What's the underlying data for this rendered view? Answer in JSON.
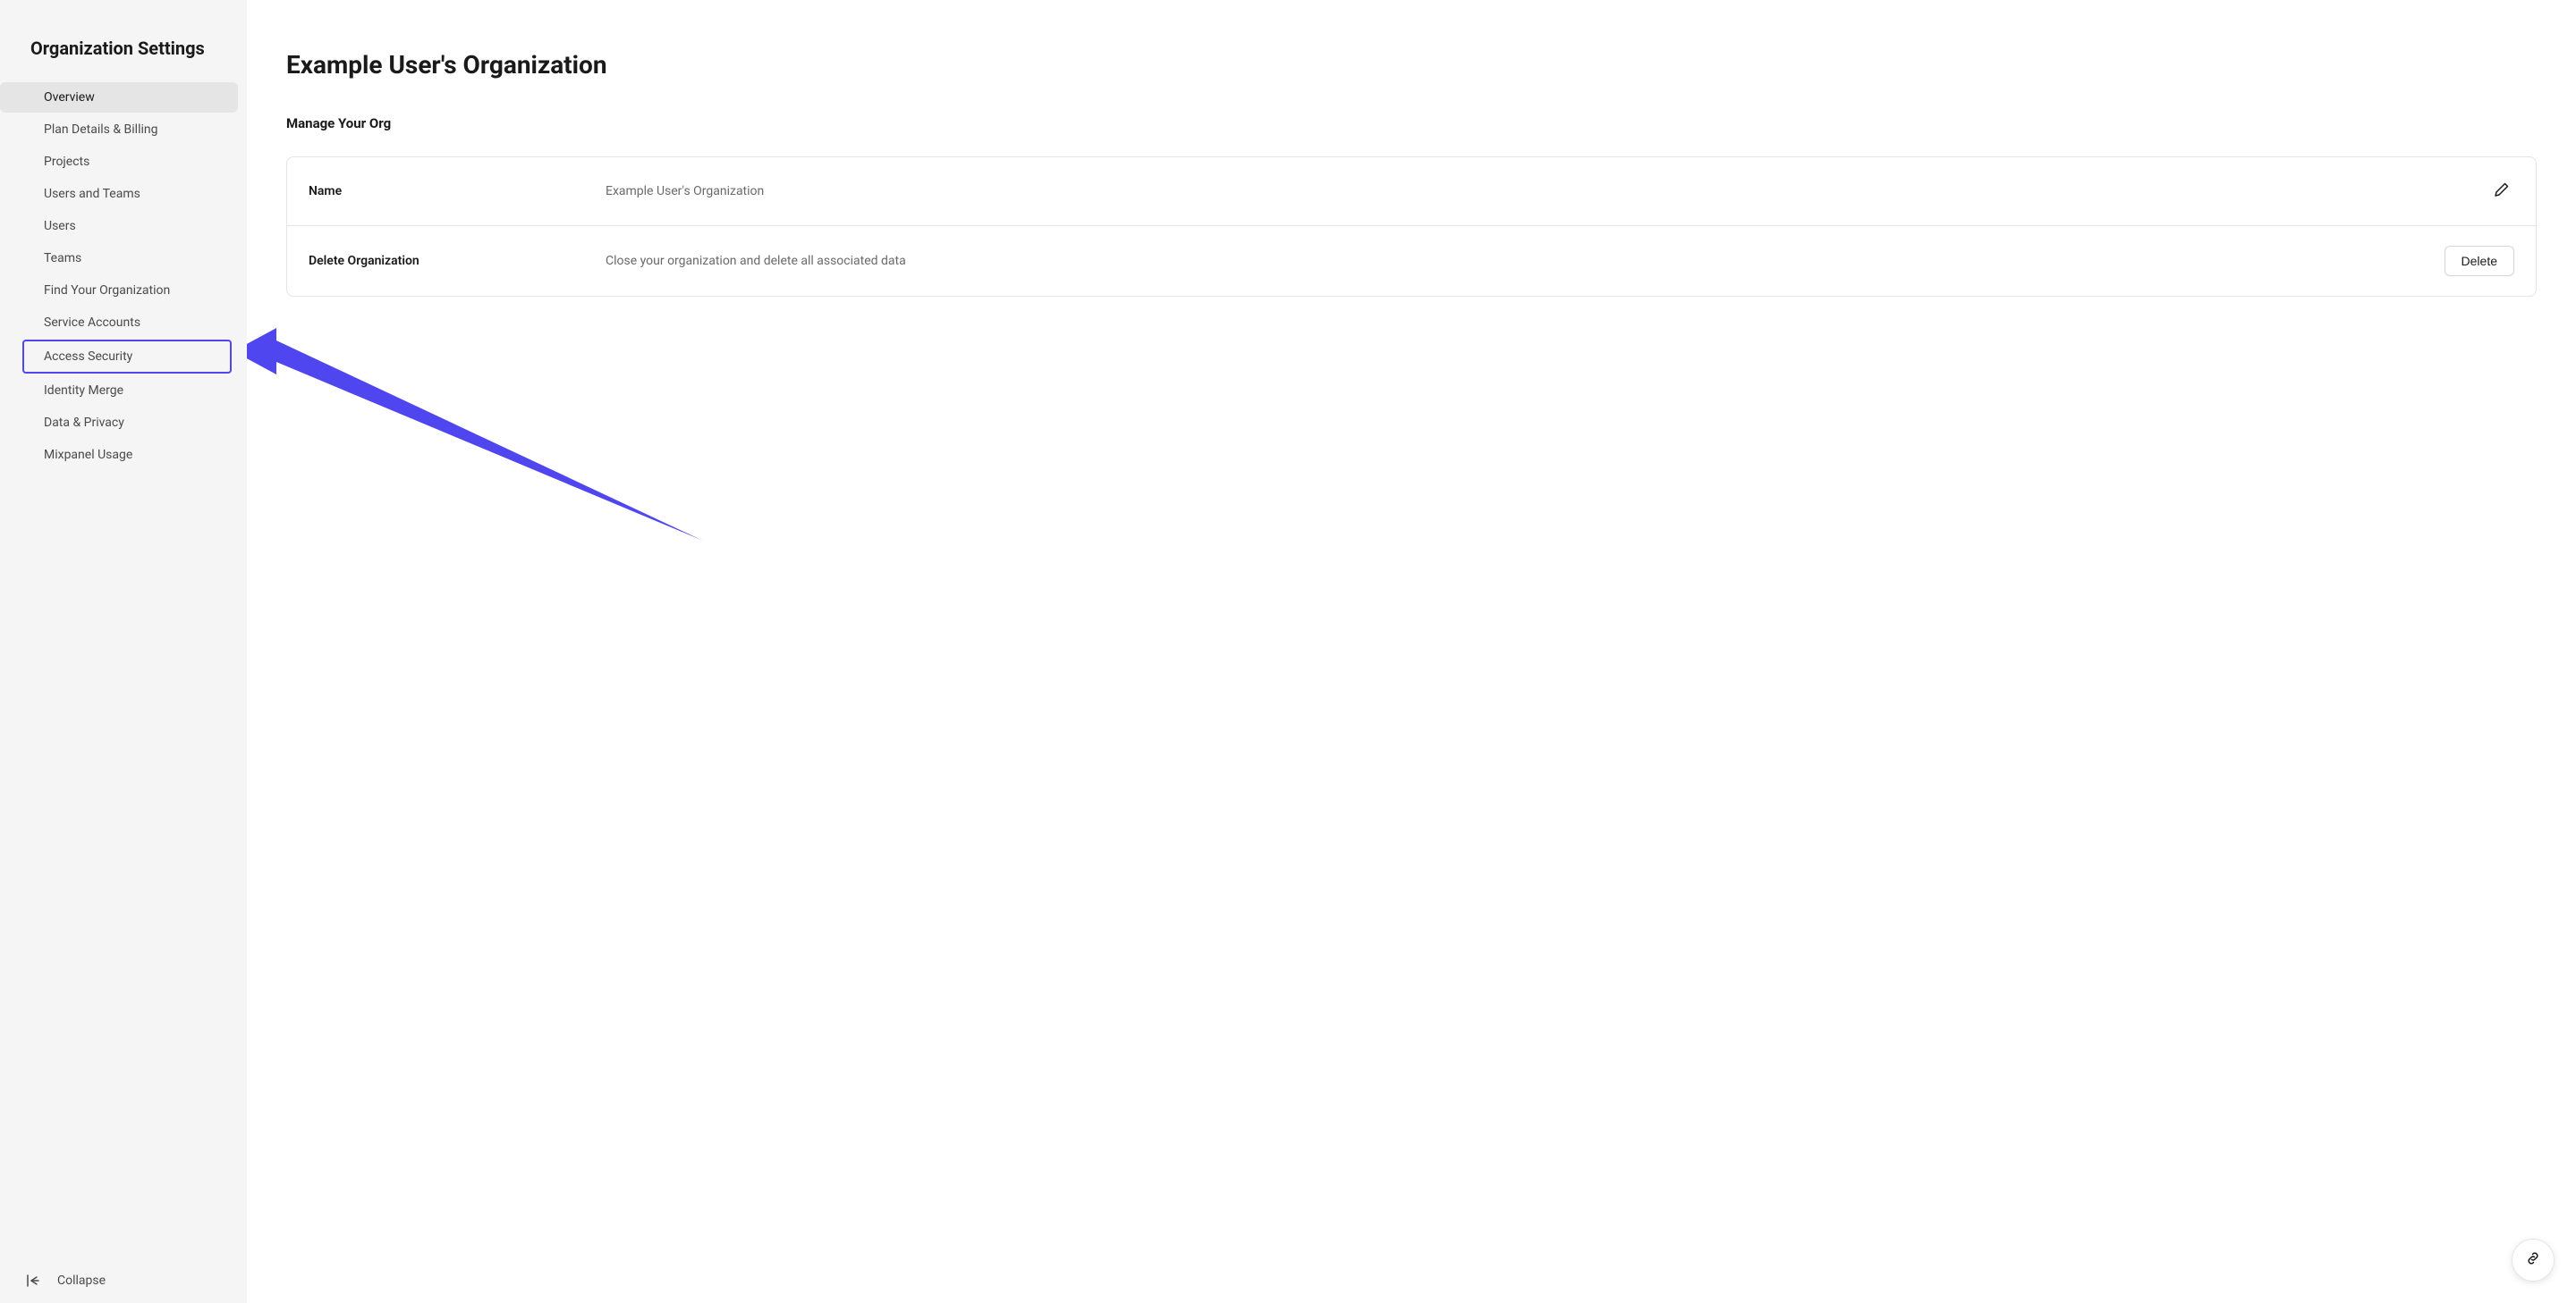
{
  "sidebar": {
    "title": "Organization Settings",
    "items": [
      {
        "label": "Overview",
        "active": true
      },
      {
        "label": "Plan Details & Billing"
      },
      {
        "label": "Projects"
      },
      {
        "label": "Users and Teams"
      },
      {
        "label": "Users"
      },
      {
        "label": "Teams"
      },
      {
        "label": "Find Your Organization"
      },
      {
        "label": "Service Accounts"
      },
      {
        "label": "Access Security",
        "highlighted": true
      },
      {
        "label": "Identity Merge"
      },
      {
        "label": "Data & Privacy"
      },
      {
        "label": "Mixpanel Usage"
      }
    ],
    "collapse_label": "Collapse"
  },
  "main": {
    "page_title": "Example User's Organization",
    "section_title": "Manage Your Org",
    "rows": [
      {
        "label": "Name",
        "value": "Example User's Organization",
        "action_type": "edit"
      },
      {
        "label": "Delete Organization",
        "value": "Close your organization and delete all associated data",
        "action_type": "delete",
        "action_label": "Delete"
      }
    ]
  },
  "annotation": {
    "color": "#5046ef"
  }
}
